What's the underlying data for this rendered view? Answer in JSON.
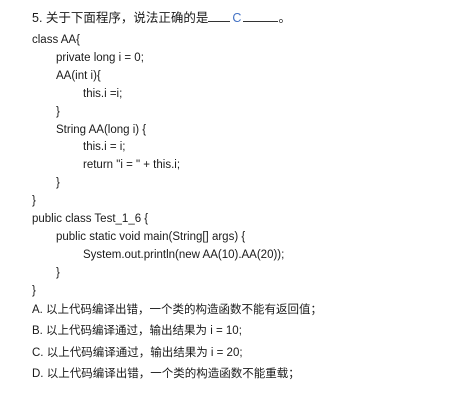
{
  "question": {
    "prefix": "5. 关于下面程序，说法正确的是",
    "answer": "C",
    "suffix": "。"
  },
  "code": [
    {
      "text": "class AA{",
      "indent": 0
    },
    {
      "text": "private long i = 0;",
      "indent": 1
    },
    {
      "text": "AA(int i){",
      "indent": 1
    },
    {
      "text": "this.i =i;",
      "indent": 2
    },
    {
      "text": "}",
      "indent": 1
    },
    {
      "text": "String AA(long i) {",
      "indent": 1
    },
    {
      "text": "this.i = i;",
      "indent": 2
    },
    {
      "text": "return   \"i = \" + this.i;",
      "indent": 2
    },
    {
      "text": "}",
      "indent": 1
    },
    {
      "text": "}",
      "indent": 0
    },
    {
      "text": "public class Test_1_6 {",
      "indent": 0
    },
    {
      "text": "public static void main(String[] args) {",
      "indent": 1
    },
    {
      "text": "System.out.println(new AA(10).AA(20));",
      "indent": 2
    },
    {
      "text": "}",
      "indent": 1
    },
    {
      "text": "}",
      "indent": 0
    }
  ],
  "options": [
    "A. 以上代码编译出错，一个类的构造函数不能有返回值；",
    "B. 以上代码编译通过，输出结果为 i = 10;",
    "C. 以上代码编译通过，输出结果为 i = 20;",
    "D. 以上代码编译出错，一个类的构造函数不能重载；"
  ]
}
